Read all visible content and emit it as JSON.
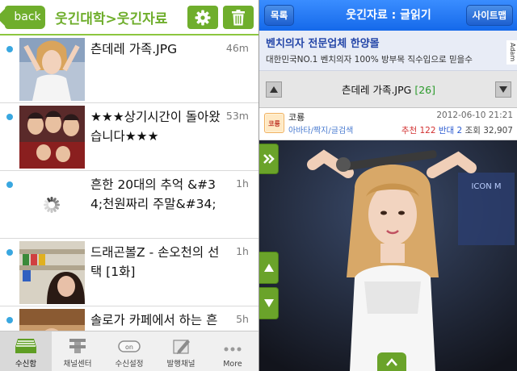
{
  "left": {
    "back_label": "back",
    "title": "웃긴대학>웃긴자료",
    "settings_icon": "gear-icon",
    "delete_icon": "trash-icon",
    "colors": {
      "accent": "#6fae2c",
      "unread_dot": "#39a7e0"
    },
    "items": [
      {
        "title": "츤데레 가족.JPG",
        "time": "46m",
        "thumb": "photo"
      },
      {
        "title": "★★★상기시간이 돌아왔습니다★★★",
        "time": "53m",
        "thumb": "photo"
      },
      {
        "title": "흔한 20대의 추억 &#34;천원짜리 주말&#34;",
        "time": "1h",
        "thumb": "loading"
      },
      {
        "title": "드래곤볼Z - 손오천의 선택 [1화]",
        "time": "1h",
        "thumb": "photo"
      },
      {
        "title": "솔로가 카페에서 하는 흔한 행동",
        "time": "5h",
        "thumb": "photo"
      }
    ],
    "tabs": [
      {
        "label": "수신함",
        "icon": "inbox-icon",
        "active": true
      },
      {
        "label": "채널센터",
        "icon": "channel-center-icon",
        "active": false
      },
      {
        "label": "수신설정",
        "icon": "toggle-icon",
        "toggle_text": "on",
        "active": false
      },
      {
        "label": "발행채널",
        "icon": "pen-icon",
        "active": false
      },
      {
        "label": "More",
        "icon": "more-icon",
        "active": false
      }
    ]
  },
  "right": {
    "list_button": "목록",
    "title": "웃긴자료 : 글읽기",
    "sitemap_button": "사이트맵",
    "ad": {
      "title": "벤치의자 전문업체 한양몰",
      "desc": "대한민국NO.1 벤치의자 100% 방부목 직수입으로 믿을수",
      "badge": "Adam"
    },
    "post": {
      "file_name": "츤데레 가족.JPG",
      "count": "[26]",
      "author": "코룡",
      "category": "아바타/짝지/글검색",
      "avatar_text": "코룡",
      "date": "2012-06-10 21:21",
      "recommend_label": "추천",
      "recommend_count": "122",
      "oppose_label": "반대",
      "oppose_count": "2",
      "views_label": "조회",
      "views_count": "32,907"
    },
    "photo_banner": "ICON M"
  }
}
